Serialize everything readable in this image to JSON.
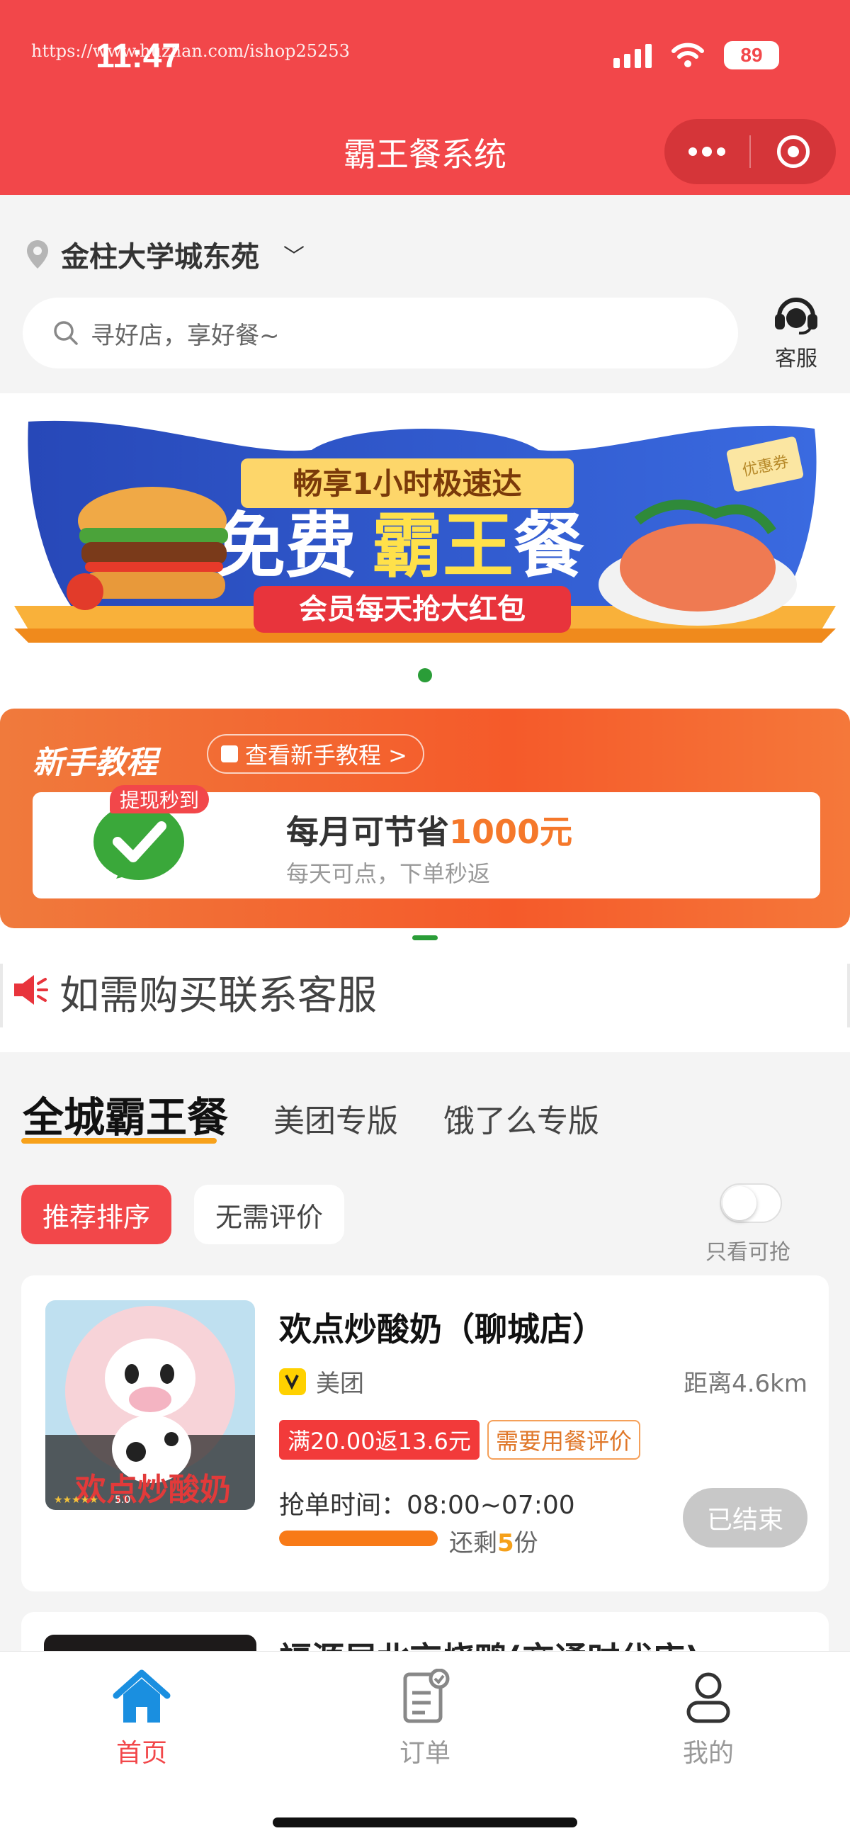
{
  "status_bar": {
    "time": "11:47",
    "watermark": "https://www.huzhan.com/ishop25253",
    "battery": "89"
  },
  "nav": {
    "title": "霸王餐系统"
  },
  "location": {
    "name": "金柱大学城东苑"
  },
  "search": {
    "placeholder": "寻好店，享好餐~"
  },
  "service": {
    "label": "客服"
  },
  "banner": {
    "tagline": "畅享1小时极速达",
    "headline_part1": "免费",
    "headline_part2": "霸王",
    "headline_part3": "餐",
    "ribbon": "会员每天抢大红包",
    "coupon": "优惠券"
  },
  "tutorial": {
    "title": "新手教程",
    "link": "查看新手教程 >",
    "badge": "提现秒到",
    "headline_prefix": "每月可节省",
    "headline_amount": "1000元",
    "subtitle": "每天可点，下单秒返"
  },
  "notice": {
    "text": "如需购买联系客服"
  },
  "tabs": [
    {
      "label": "全城霸王餐"
    },
    {
      "label": "美团专版"
    },
    {
      "label": "饿了么专版"
    }
  ],
  "filters": {
    "sort": "推荐排序",
    "no_review": "无需评价",
    "only_available": "只看可抢"
  },
  "store": {
    "name": "欢点炒酸奶（聊城店）",
    "platform": "美团",
    "distance": "距离4.6km",
    "promo": "满20.00返13.6元",
    "requirement": "需要用餐评价",
    "grab_time": "抢单时间：08:00~07:00",
    "remain_prefix": "还剩",
    "remain_count": "5",
    "remain_suffix": "份",
    "progress": 1.0,
    "status_button": "已结束",
    "thumb_rating": "5.0",
    "thumb_brand": "欢点炒酸奶"
  },
  "store2": {
    "name_partial": "福源居北京烧鸭(交通时代店)"
  },
  "tabbar": [
    {
      "label": "首页",
      "icon": "home-icon"
    },
    {
      "label": "订单",
      "icon": "order-icon"
    },
    {
      "label": "我的",
      "icon": "user-icon"
    }
  ],
  "colors": {
    "brand": "#f2474a",
    "accent": "#f7a11a",
    "progress": "#f87a17"
  }
}
